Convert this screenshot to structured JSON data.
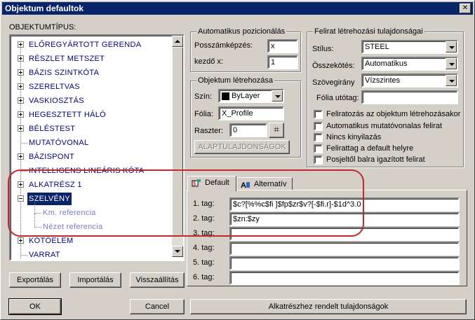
{
  "window": {
    "title": "Objektum defaultok"
  },
  "tree": {
    "label": "OBJEKTUMTÍPUS:",
    "items": [
      {
        "label": "ELŐREGYÁRTOTT GERENDA",
        "expander": "plus"
      },
      {
        "label": "RÉSZLET METSZET",
        "expander": "plus"
      },
      {
        "label": "BÁZIS SZINTKÓTA",
        "expander": "plus"
      },
      {
        "label": "SZERELTVAS",
        "expander": "plus"
      },
      {
        "label": "VASKIOSZTÁS",
        "expander": "plus"
      },
      {
        "label": "HEGESZTETT HÁLÓ",
        "expander": "plus"
      },
      {
        "label": "BÉLÉSTEST",
        "expander": "plus"
      },
      {
        "label": "MUTATÓVONAL",
        "expander": "none"
      },
      {
        "label": "BÁZISPONT",
        "expander": "plus"
      },
      {
        "label": "INTELLIGENS LINEÁRIS KÓTA",
        "expander": "none"
      },
      {
        "label": "ALKATRÉSZ 1",
        "expander": "plus"
      },
      {
        "label": "SZELVÉNY",
        "expander": "minus",
        "selected": true
      },
      {
        "label": "Km. referencia",
        "child": true
      },
      {
        "label": "Nézet referencia",
        "child": true
      },
      {
        "label": "KÖTŐELEM",
        "expander": "plus"
      },
      {
        "label": "VARRAT",
        "expander": "none"
      }
    ]
  },
  "buttons": {
    "export": "Exportálás",
    "import": "Importálás",
    "restore": "Visszaállítás",
    "ok": "OK",
    "cancel": "Cancel",
    "part_props": "Alkatrészhez rendelt tulajdonságok",
    "base_props": "ALAPTULAJDONSÁGOK"
  },
  "auto_pos": {
    "title": "Automatikus pozicionálás",
    "count_label": "Posszámképzés:",
    "count_value": "x",
    "start_label": "kezdő x:",
    "start_value": "1"
  },
  "creation": {
    "title": "Objektum létrehozása",
    "color_label": "Szín:",
    "color_value": "ByLayer",
    "color_swatch": "#000000",
    "layer_label": "Fólia:",
    "layer_value": "X_Profile",
    "raster_label": "Raszter:",
    "raster_value": "0"
  },
  "label_props": {
    "title": "Felirat létrehozási tulajdonságai",
    "style_label": "Stílus:",
    "style_value": "STEEL",
    "link_label": "Összekötés:",
    "link_value": "Automatikus",
    "angle_label": "Szövegirány",
    "angle_value": "Vízszintes",
    "suffix_label": "Fólia utótag:",
    "suffix_value": "",
    "checkboxes": [
      "Feliratozás az objektum létrehozásakor",
      "Automatikus mutatóvonalas felirat",
      "Nincs kinyilazás",
      "Felirattag a default helyre",
      "Posjeltől balra igazított felirat"
    ]
  },
  "tabs": [
    {
      "label": "Default",
      "active": true
    },
    {
      "label": "Alternatív",
      "active": false
    }
  ],
  "tags": [
    {
      "label": "1. tag:",
      "value": "$c?[%%c$fi ]$fp$zr$v?[-$fi.r]-$1d^3.0"
    },
    {
      "label": "2. tag:",
      "value": "$zn:$zy"
    },
    {
      "label": "3. tag:",
      "value": ""
    },
    {
      "label": "4. tag:",
      "value": ""
    },
    {
      "label": "5. tag:",
      "value": ""
    },
    {
      "label": "6. tag:",
      "value": ""
    }
  ]
}
